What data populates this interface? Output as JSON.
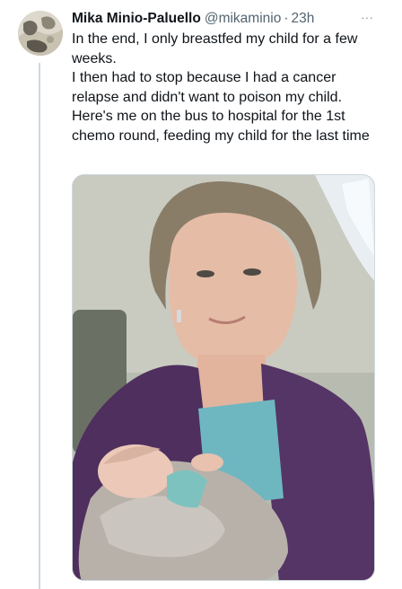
{
  "tweet": {
    "display_name": "Mika Minio-Paluello",
    "handle": "@mikaminio",
    "separator": "·",
    "time": "23h",
    "more_label": "···",
    "text_lines": [
      "In the end, I only breastfed my child for a few weeks.",
      "I then had to stop because I had a cancer relapse and didn't want to poison my child. Here's me on the bus to hospital for the 1st chemo round, feeding my child for the last time"
    ],
    "avatar_icon": "profile-avatar",
    "more_icon": "more-options-icon"
  },
  "colors": {
    "text_primary": "#0f1419",
    "text_secondary": "#536471",
    "thread_line": "#cfd9de"
  }
}
